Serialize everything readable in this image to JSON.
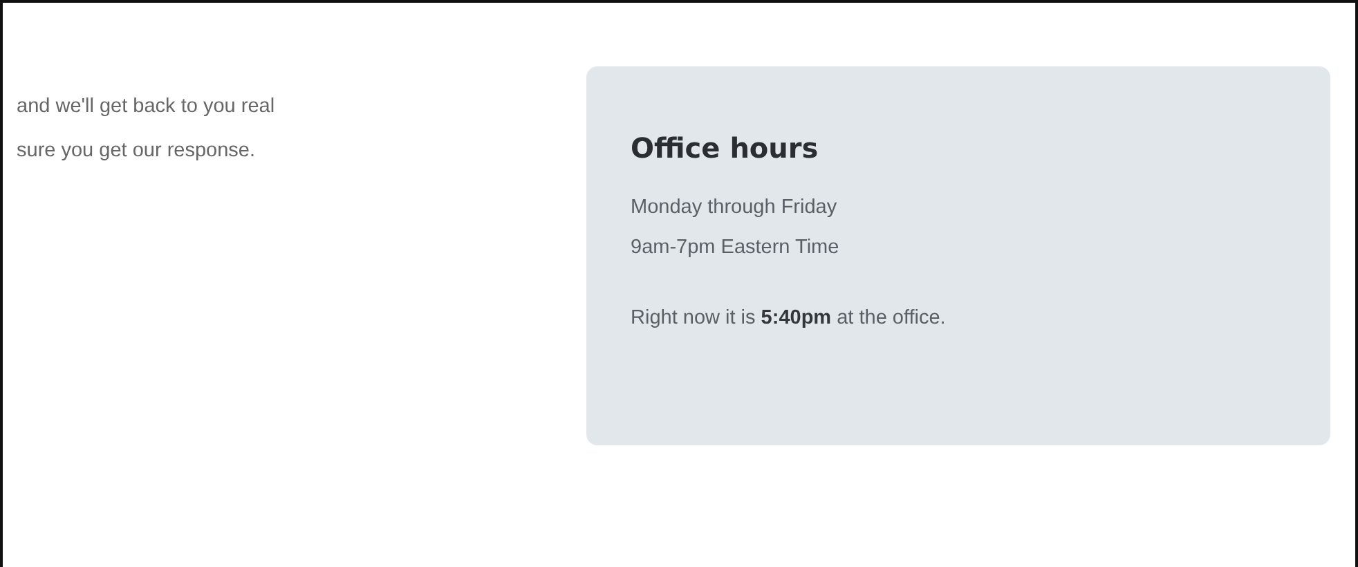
{
  "intro_lines": [
    "and we'll get back to you real",
    "sure you get our response."
  ],
  "office_hours": {
    "title": "Office hours",
    "lines": [
      "Monday through Friday",
      "9am-7pm Eastern Time"
    ],
    "current_time": "Right now it is **5:40pm** at the office."
  }
}
